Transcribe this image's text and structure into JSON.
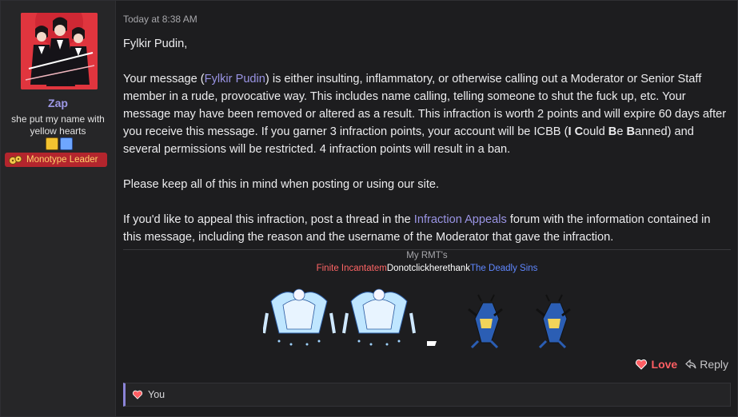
{
  "author": {
    "username": "Zap",
    "user_title": "she put my name with yellow hearts",
    "banner": "Monotype Leader"
  },
  "message": {
    "timestamp": "Today at 8:38 AM",
    "greeting": "Fylkir Pudin,",
    "p1_a": "Your message (",
    "p1_link": "Fylkir Pudin",
    "p1_b": ") is either insulting, inflammatory, or otherwise calling out a Moderator or Senior Staff member in a rude, provocative way. This includes name calling, telling someone to shut the fuck up, etc. Your message may have been removed or altered as a result. This infraction is worth 2 points and will expire 60 days after you receive this message. If you garner 3 infraction points, your account will be ICBB (",
    "icbb_I": "I",
    "icbb_c1": " C",
    "icbb_c2": "ould ",
    "icbb_B1": "B",
    "icbb_e": "e ",
    "icbb_B2": "B",
    "icbb_anned": "anned",
    "p1_c": ") and several permissions will be restricted. 4 infraction points will result in a ban.",
    "p2": "Please keep all of this in mind when posting or using our site.",
    "p3_a": "If you'd like to appeal this infraction, post a thread in the ",
    "p3_link": "Infraction Appeals",
    "p3_b": " forum with the information contained in this message, including the reason and the username of the Moderator that gave the infraction."
  },
  "signature": {
    "title": "My RMT's",
    "teams": [
      "Finite Incantatem",
      "Donotclickherethank",
      "The Deadly Sins"
    ]
  },
  "actions": {
    "love": "Love",
    "reply": "Reply"
  },
  "reactions": {
    "label": "You"
  },
  "colors": {
    "accent": "#9a94e4",
    "love": "#ff5e63",
    "banner_bg": "#b3252d",
    "banner_text": "#ffd36b"
  }
}
